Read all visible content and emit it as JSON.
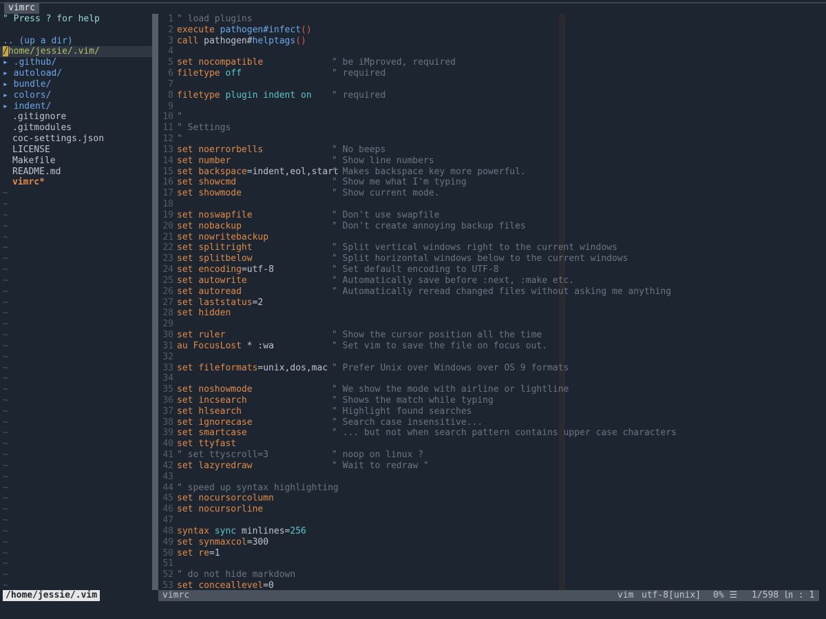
{
  "tab": {
    "label": "vimrc"
  },
  "tree": {
    "help": "\" Press ? for help",
    "up": ".. (up a dir)",
    "root_cursor": "/",
    "root_rest": "home/jessie/.vim/",
    "dirs": [
      "▸ .github/",
      "▸ autoload/",
      "▸ bundle/",
      "▸ colors/",
      "▸ indent/"
    ],
    "files": [
      ".gitignore",
      ".gitmodules",
      "coc-settings.json",
      "LICENSE",
      "Makefile",
      "README.md"
    ],
    "modified_file": "vimrc*",
    "tilde": "~"
  },
  "editor": {
    "lines": [
      {
        "n": "1",
        "a": "\" load plugins",
        "t": "c"
      },
      {
        "n": "2",
        "kw": "execute",
        "rest": "pathogen#infect",
        "t": "fn"
      },
      {
        "n": "3",
        "kw": "call",
        "plain": "pathogen#",
        "rest": "helptags",
        "t": "fn"
      },
      {
        "n": "4",
        "t": "e"
      },
      {
        "n": "5",
        "kw": "set",
        "opt": "nocompatible",
        "c": "\" be iMproved, required",
        "t": "s"
      },
      {
        "n": "6",
        "kw": "filetype",
        "opt": "off",
        "c": "\" required",
        "t": "s2"
      },
      {
        "n": "7",
        "t": "e"
      },
      {
        "n": "8",
        "kw": "filetype",
        "opt": "plugin indent on",
        "c": "\" required",
        "t": "s2"
      },
      {
        "n": "9",
        "t": "e"
      },
      {
        "n": "10",
        "a": "\"",
        "t": "c"
      },
      {
        "n": "11",
        "a": "\" Settings",
        "t": "c"
      },
      {
        "n": "12",
        "a": "\"",
        "t": "c"
      },
      {
        "n": "13",
        "kw": "set",
        "opt": "noerrorbells",
        "c": "\" No beeps",
        "t": "s"
      },
      {
        "n": "14",
        "kw": "set",
        "opt": "number",
        "c": "\" Show line numbers",
        "t": "s"
      },
      {
        "n": "15",
        "kw": "set",
        "opt": "backspace",
        "val": "=indent,eol,start",
        "c": "\" Makes backspace key more powerful.",
        "t": "s"
      },
      {
        "n": "16",
        "kw": "set",
        "opt": "showcmd",
        "c": "\" Show me what I'm typing",
        "t": "s"
      },
      {
        "n": "17",
        "kw": "set",
        "opt": "showmode",
        "c": "\" Show current mode.",
        "t": "s"
      },
      {
        "n": "18",
        "t": "e"
      },
      {
        "n": "19",
        "kw": "set",
        "opt": "noswapfile",
        "c": "\" Don't use swapfile",
        "t": "s"
      },
      {
        "n": "20",
        "kw": "set",
        "opt": "nobackup",
        "c": "\" Don't create annoying backup files",
        "t": "s"
      },
      {
        "n": "21",
        "kw": "set",
        "opt": "nowritebackup",
        "t": "s"
      },
      {
        "n": "22",
        "kw": "set",
        "opt": "splitright",
        "c": "\" Split vertical windows right to the current windows",
        "t": "s"
      },
      {
        "n": "23",
        "kw": "set",
        "opt": "splitbelow",
        "c": "\" Split horizontal windows below to the current windows",
        "t": "s"
      },
      {
        "n": "24",
        "kw": "set",
        "opt": "encoding",
        "val": "=utf-8",
        "c": "\" Set default encoding to UTF-8",
        "t": "s"
      },
      {
        "n": "25",
        "kw": "set",
        "opt": "autowrite",
        "c": "\" Automatically save before :next, :make etc.",
        "t": "s"
      },
      {
        "n": "26",
        "kw": "set",
        "opt": "autoread",
        "c": "\" Automatically reread changed files without asking me anything",
        "t": "s"
      },
      {
        "n": "27",
        "kw": "set",
        "opt": "laststatus",
        "val": "=2",
        "t": "s"
      },
      {
        "n": "28",
        "kw": "set",
        "opt": "hidden",
        "t": "s"
      },
      {
        "n": "29",
        "t": "e"
      },
      {
        "n": "30",
        "kw": "set",
        "opt": "ruler",
        "c": "\" Show the cursor position all the time",
        "t": "s"
      },
      {
        "n": "31",
        "kw": "au",
        "opt": "FocusLost",
        "val": " * :wa",
        "c": "\" Set vim to save the file on focus out.",
        "t": "au"
      },
      {
        "n": "32",
        "t": "e"
      },
      {
        "n": "33",
        "kw": "set",
        "opt": "fileformats",
        "val": "=unix,dos,mac",
        "c": "\" Prefer Unix over Windows over OS 9 formats",
        "t": "s"
      },
      {
        "n": "34",
        "t": "e"
      },
      {
        "n": "35",
        "kw": "set",
        "opt": "noshowmode",
        "c": "\" We show the mode with airline or lightline",
        "t": "s"
      },
      {
        "n": "36",
        "kw": "set",
        "opt": "incsearch",
        "c": "\" Shows the match while typing",
        "t": "s"
      },
      {
        "n": "37",
        "kw": "set",
        "opt": "hlsearch",
        "c": "\" Highlight found searches",
        "t": "s"
      },
      {
        "n": "38",
        "kw": "set",
        "opt": "ignorecase",
        "c": "\" Search case insensitive...",
        "t": "s"
      },
      {
        "n": "39",
        "kw": "set",
        "opt": "smartcase",
        "c": "\" ... but not when search pattern contains upper case characters",
        "t": "s"
      },
      {
        "n": "40",
        "kw": "set",
        "opt": "ttyfast",
        "t": "s"
      },
      {
        "n": "41",
        "a": "\" set ttyscroll=3",
        "c": "\" noop on linux ?",
        "t": "cc"
      },
      {
        "n": "42",
        "kw": "set",
        "opt": "lazyredraw",
        "c": "\" Wait to redraw \"",
        "t": "s"
      },
      {
        "n": "43",
        "t": "e"
      },
      {
        "n": "44",
        "a": "\" speed up syntax highlighting",
        "t": "c"
      },
      {
        "n": "45",
        "kw": "set",
        "opt": "nocursorcolumn",
        "t": "s"
      },
      {
        "n": "46",
        "kw": "set",
        "opt": "nocursorline",
        "t": "s"
      },
      {
        "n": "47",
        "t": "e"
      },
      {
        "n": "48",
        "kw": "syntax",
        "opt": "sync",
        "val": " minlines=",
        "num": "256",
        "t": "syn"
      },
      {
        "n": "49",
        "kw": "set",
        "opt": "synmaxcol",
        "val": "=300",
        "t": "s"
      },
      {
        "n": "50",
        "kw": "set",
        "opt": "re",
        "val": "=1",
        "t": "s"
      },
      {
        "n": "51",
        "t": "e"
      },
      {
        "n": "52",
        "a": "\" do not hide markdown",
        "t": "c"
      },
      {
        "n": "53",
        "kw": "set",
        "opt": "conceallevel",
        "val": "=0",
        "t": "s"
      }
    ]
  },
  "status": {
    "tree_path": "/home/jessie/.vim",
    "file": "vimrc",
    "filetype": "vim",
    "encoding": "utf-8[unix]",
    "percent": "0% ☰",
    "position": "1/598 ㏑ :  1"
  }
}
